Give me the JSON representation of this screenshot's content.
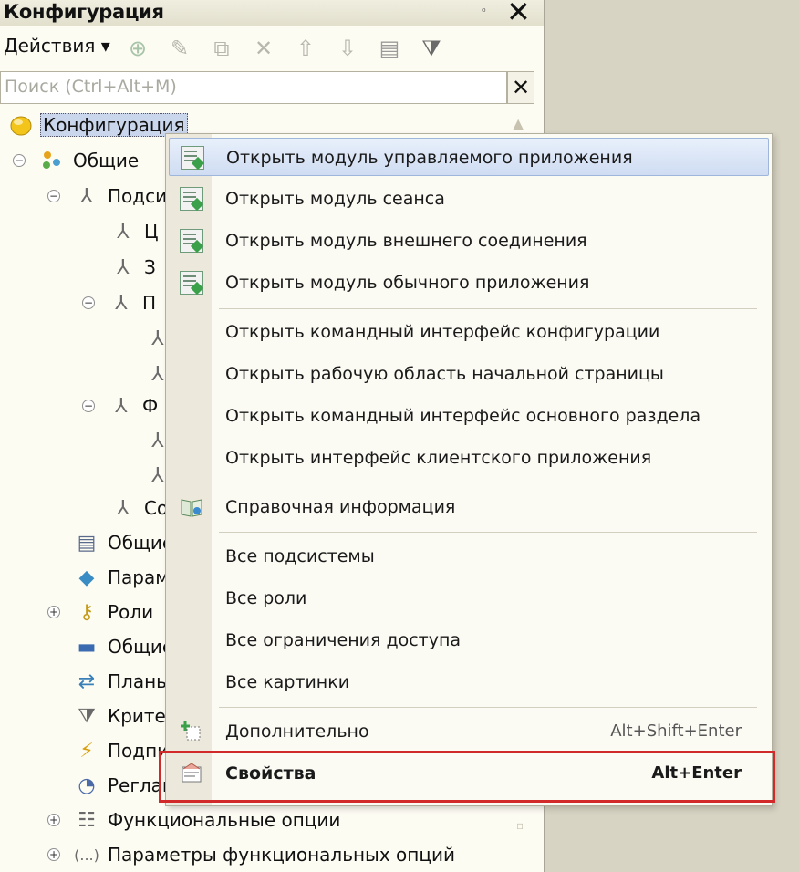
{
  "window": {
    "title": "Конфигурация",
    "pin_label": "ₒ",
    "close_glyph": "✕"
  },
  "toolbar": {
    "actions_label": "Действия ▾",
    "icons": {
      "add": "⊕",
      "edit": "✎",
      "copy": "⧉",
      "delete": "✕",
      "up": "⇧",
      "down": "⇩",
      "list": "▤",
      "filter": "⧩"
    }
  },
  "search": {
    "placeholder": "Поиск (Ctrl+Alt+M)",
    "value": "",
    "clear_glyph": "✕"
  },
  "tree": {
    "root": "Конфигурация",
    "common": "Общие",
    "subsystems": "Подсистемы",
    "sub_c": "Ц",
    "sub_z": "З",
    "sub_p": "П",
    "sub_f": "Ф",
    "sub_s": "Со",
    "common_modules": "Общие модули",
    "params": "Параметры сеанса",
    "roles": "Роли",
    "common_attrs": "Общие реквизиты",
    "plans": "Планы обмена",
    "criteria": "Критерии отбора",
    "subscriptions": "Подписки на события",
    "routine": "Регламентные задания",
    "func_options": "Функциональные опции",
    "func_params": "Параметры функциональных опций"
  },
  "menu": {
    "items": {
      "open_managed_app_module": "Открыть модуль управляемого приложения",
      "open_session_module": "Открыть модуль сеанса",
      "open_external_conn_module": "Открыть модуль внешнего соединения",
      "open_ordinary_app_module": "Открыть модуль обычного приложения",
      "open_command_interface": "Открыть командный интерфейс конфигурации",
      "open_home_page_workspace": "Открыть рабочую область начальной страницы",
      "open_main_section_interface": "Открыть командный интерфейс основного раздела",
      "open_client_app_interface": "Открыть интерфейс клиентского приложения",
      "help_info": "Справочная информация",
      "all_subsystems": "Все подсистемы",
      "all_roles": "Все роли",
      "all_access_restrictions": "Все ограничения доступа",
      "all_pictures": "Все картинки",
      "additional": "Дополнительно",
      "additional_shortcut": "Alt+Shift+Enter",
      "properties": "Свойства",
      "properties_shortcut": "Alt+Enter"
    }
  },
  "colors": {
    "highlight_border": "#d22a2a",
    "hover_bg": "#cfdcf2",
    "window_bg": "#fdfcf3"
  }
}
